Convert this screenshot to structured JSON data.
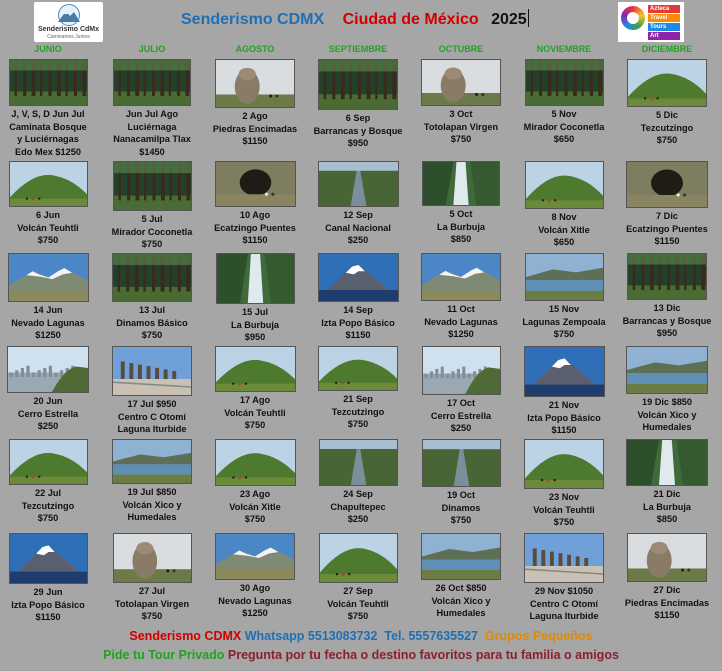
{
  "header": {
    "logo_left": {
      "title": "Senderismo CdMx",
      "subtitle": "Caminamos Juntos"
    },
    "logo_right": {
      "lines": [
        "Azteca",
        "Travel",
        "Tours",
        "Art"
      ]
    },
    "title": {
      "brand": "Senderismo CDMX",
      "city": "Ciudad de México",
      "year": "2025"
    }
  },
  "months": [
    "JUNIO",
    "JULIO",
    "AGOSTO",
    "SEPTIEMBRE",
    "OCTUBRE",
    "NOVIEMBRE",
    "DICIEMBRE"
  ],
  "tours": [
    [
      {
        "lines": [
          "J, V, S, D Jun Jul",
          "Caminata Bosque",
          "y Luciérnagas",
          "Edo Mex  $1250"
        ],
        "scene": "forest"
      },
      {
        "lines": [
          "6 Jun",
          "Volcán Teuhtli",
          "$750"
        ],
        "scene": "hill"
      },
      {
        "lines": [
          "14 Jun",
          "Nevado Lagunas",
          "$1250"
        ],
        "scene": "snow"
      },
      {
        "lines": [
          "20 Jun",
          "Cerro Estrella",
          "$250"
        ],
        "scene": "city"
      },
      {
        "lines": [
          "22 Jul",
          "Tezcutzingo",
          "$750"
        ],
        "scene": "hill"
      },
      {
        "lines": [
          "29 Jun",
          "Izta Popo Básico",
          "$1150"
        ],
        "scene": "volcano"
      }
    ],
    [
      {
        "lines": [
          "Jun Jul Ago",
          "Luciérnaga",
          "Nanacamilpa Tlax",
          "$1450"
        ],
        "scene": "forest"
      },
      {
        "lines": [
          "5 Jul",
          "Mirador Coconetla",
          "$750"
        ],
        "scene": "forest"
      },
      {
        "lines": [
          "13 Jul",
          "Dinamos Básico",
          "$750"
        ],
        "scene": "forest"
      },
      {
        "lines": [
          "17 Jul $950",
          "Centro C Otomí",
          "Laguna Iturbide"
        ],
        "scene": "statues"
      },
      {
        "lines": [
          "19 Jul $850",
          "Volcán Xico y",
          "Humedales"
        ],
        "scene": "lake"
      },
      {
        "lines": [
          "27 Jul",
          "Totolapan Virgen",
          "$750"
        ],
        "scene": "rock"
      }
    ],
    [
      {
        "lines": [
          "2 Ago",
          "Piedras Encimadas",
          "$1150"
        ],
        "scene": "rock"
      },
      {
        "lines": [
          "10 Ago",
          "Ecatzingo Puentes",
          "$1150"
        ],
        "scene": "tunnel"
      },
      {
        "lines": [
          "15 Jul",
          "La Burbuja",
          "$950"
        ],
        "scene": "waterfall"
      },
      {
        "lines": [
          "17 Ago",
          "Volcán Teuhtli",
          "$750"
        ],
        "scene": "hill"
      },
      {
        "lines": [
          "23 Ago",
          "Volcán Xitle",
          "$750"
        ],
        "scene": "hill"
      },
      {
        "lines": [
          "30 Ago",
          "Nevado Lagunas",
          "$1250"
        ],
        "scene": "snow"
      }
    ],
    [
      {
        "lines": [
          "6 Sep",
          "Barrancas y Bosque",
          "$950"
        ],
        "scene": "forest"
      },
      {
        "lines": [
          "12 Sep",
          "Canal Nacional",
          "$250"
        ],
        "scene": "canal"
      },
      {
        "lines": [
          "14 Sep",
          "Izta Popo Básico",
          "$1150"
        ],
        "scene": "volcano"
      },
      {
        "lines": [
          "21 Sep",
          "Tezcutzingo",
          "$750"
        ],
        "scene": "hill"
      },
      {
        "lines": [
          "24 Sep",
          "Chapultepec",
          "$250"
        ],
        "scene": "canal"
      },
      {
        "lines": [
          "27 Sep",
          "Volcán Teuhtli",
          "$750"
        ],
        "scene": "hill"
      }
    ],
    [
      {
        "lines": [
          "3 Oct",
          "Totolapan Virgen",
          "$750"
        ],
        "scene": "rock"
      },
      {
        "lines": [
          "5 Oct",
          "La Burbuja",
          "$850"
        ],
        "scene": "waterfall"
      },
      {
        "lines": [
          "11 Oct",
          "Nevado Lagunas",
          "$1250"
        ],
        "scene": "snow"
      },
      {
        "lines": [
          "17 Oct",
          "Cerro Estrella",
          "$250"
        ],
        "scene": "city"
      },
      {
        "lines": [
          "19 Oct",
          "Dinamos",
          "$750"
        ],
        "scene": "canal"
      },
      {
        "lines": [
          "26 Oct $850",
          "Volcán Xico y",
          "Humedales"
        ],
        "scene": "lake"
      }
    ],
    [
      {
        "lines": [
          "5 Nov",
          "Mirador Coconetla",
          "$650"
        ],
        "scene": "forest"
      },
      {
        "lines": [
          "8 Nov",
          "Volcán Xitle",
          "$650"
        ],
        "scene": "hill"
      },
      {
        "lines": [
          "15 Nov",
          "Lagunas Zempoala",
          "$750"
        ],
        "scene": "lake"
      },
      {
        "lines": [
          "21 Nov",
          "Izta Popo Básico",
          "$1150"
        ],
        "scene": "volcano"
      },
      {
        "lines": [
          "23 Nov",
          "Volcán Teuhtli",
          "$750"
        ],
        "scene": "hill"
      },
      {
        "lines": [
          "29 Nov $1050",
          "Centro C Otomí",
          "Laguna Iturbide"
        ],
        "scene": "statues"
      }
    ],
    [
      {
        "lines": [
          "5 Dic",
          "Tezcutzingo",
          "$750"
        ],
        "scene": "hill"
      },
      {
        "lines": [
          "7 Dic",
          "Ecatzingo Puentes",
          "$1150"
        ],
        "scene": "tunnel"
      },
      {
        "lines": [
          "13 Dic",
          "Barrancas y Bosque",
          "$950"
        ],
        "scene": "forest"
      },
      {
        "lines": [
          "19 Dic $850",
          "Volcán Xico y",
          "Humedales"
        ],
        "scene": "lake"
      },
      {
        "lines": [
          "21 Dic",
          "La Burbuja",
          "$850"
        ],
        "scene": "waterfall"
      },
      {
        "lines": [
          "27 Dic",
          "Piedras Encimadas",
          "$1150"
        ],
        "scene": "rock"
      }
    ]
  ],
  "footer": {
    "brand": "Senderismo CDMX",
    "whatsapp": "Whatsapp 5513083732",
    "tel": "Tel. 5557635527",
    "groups": "Grupos Pequeños",
    "private": "Pide tu Tour Privado",
    "ask": "Pregunta por tu fecha o destino favoritos para tu familia o amigos"
  },
  "colors": {
    "background": "#a6a6a6",
    "month": "#21a321",
    "brand_blue": "#1f6fb5",
    "red": "#d00000",
    "orange": "#e08a00"
  }
}
